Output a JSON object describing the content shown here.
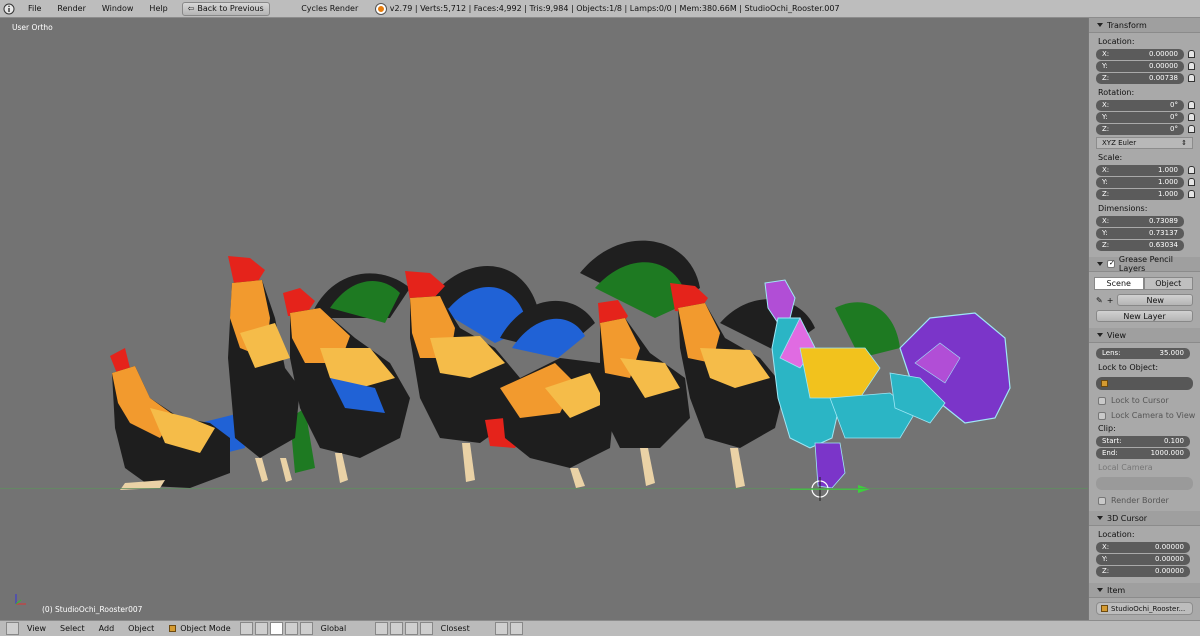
{
  "topbar": {
    "menus": [
      "File",
      "Render",
      "Window",
      "Help"
    ],
    "back_label": "Back to Previous",
    "engine": "Cycles Render",
    "stats": "v2.79 | Verts:5,712 | Faces:4,992 | Tris:9,984 | Objects:1/8 | Lamps:0/0 | Mem:380.66M | StudioOchi_Rooster.007"
  },
  "viewport": {
    "view_label": "User Ortho",
    "object_label": "(0) StudioOchi_Rooster007"
  },
  "panel": {
    "transform": {
      "title": "Transform",
      "location_label": "Location:",
      "location": [
        {
          "axis": "X:",
          "value": "0.00000"
        },
        {
          "axis": "Y:",
          "value": "0.00000"
        },
        {
          "axis": "Z:",
          "value": "0.00738"
        }
      ],
      "rotation_label": "Rotation:",
      "rotation": [
        {
          "axis": "X:",
          "value": "0°"
        },
        {
          "axis": "Y:",
          "value": "0°"
        },
        {
          "axis": "Z:",
          "value": "0°"
        }
      ],
      "rotation_mode": "XYZ Euler",
      "scale_label": "Scale:",
      "scale": [
        {
          "axis": "X:",
          "value": "1.000"
        },
        {
          "axis": "Y:",
          "value": "1.000"
        },
        {
          "axis": "Z:",
          "value": "1.000"
        }
      ],
      "dimensions_label": "Dimensions:",
      "dimensions": [
        {
          "axis": "X:",
          "value": "0.73089"
        },
        {
          "axis": "Y:",
          "value": "0.73137"
        },
        {
          "axis": "Z:",
          "value": "0.63034"
        }
      ]
    },
    "grease": {
      "title": "Grease Pencil Layers",
      "tab_scene": "Scene",
      "tab_object": "Object",
      "new_label": "New",
      "new_layer_label": "New Layer"
    },
    "view": {
      "title": "View",
      "lens_label": "Lens:",
      "lens_value": "35.000",
      "lock_to_object": "Lock to Object:",
      "lock_to_cursor": "Lock to Cursor",
      "lock_camera": "Lock Camera to View",
      "clip_label": "Clip:",
      "clip_start_label": "Start:",
      "clip_start": "0.100",
      "clip_end_label": "End:",
      "clip_end": "1000.000",
      "local_camera": "Local Camera",
      "render_border": "Render Border"
    },
    "cursor": {
      "title": "3D Cursor",
      "location_label": "Location:",
      "location": [
        {
          "axis": "X:",
          "value": "0.00000"
        },
        {
          "axis": "Y:",
          "value": "0.00000"
        },
        {
          "axis": "Z:",
          "value": "0.00000"
        }
      ]
    },
    "item": {
      "title": "Item",
      "name": "StudioOchi_Rooster..."
    }
  },
  "bottombar": {
    "menus": [
      "View",
      "Select",
      "Add",
      "Object"
    ],
    "mode": "Object Mode",
    "orientation": "Global",
    "snap": "Closest"
  },
  "colors": {
    "selected_outline": "#9fe7f6",
    "comb": "#e5231b",
    "body_orange": "#f29a2e",
    "body_yellow": "#f5bc49",
    "tail_blue": "#2062d6",
    "tail_green": "#1e7a22",
    "dark_body": "#1e1e1e",
    "leg": "#ead2a6"
  }
}
